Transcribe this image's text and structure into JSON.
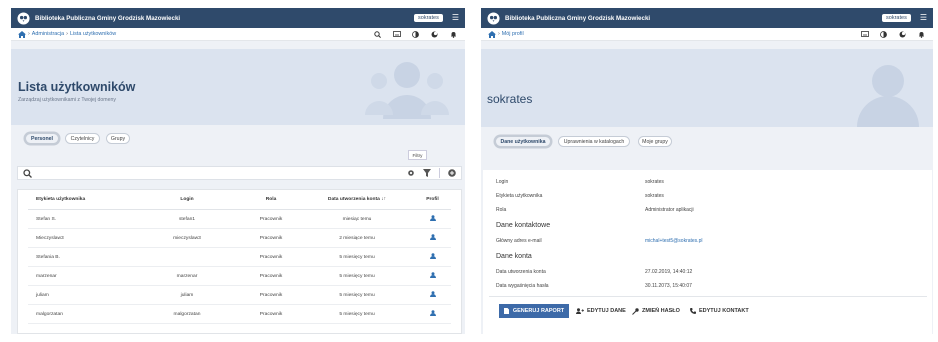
{
  "left": {
    "app_title": "Biblioteka Publiczna Gminy Grodzisk Mazowiecki",
    "user_badge": "sokrates",
    "breadcrumb": [
      "Administracja",
      "Lista użytkowników"
    ],
    "page_title": "Lista użytkowników",
    "page_subtitle": "Zarządzaj użytkownikami z Twojej domeny",
    "tabs": [
      {
        "label": "Personel",
        "active": true
      },
      {
        "label": "Czytelnicy",
        "active": false
      },
      {
        "label": "Grupy",
        "active": false
      }
    ],
    "filter_tooltip": "Filtry",
    "table": {
      "headers": [
        "Etykieta użytkownika",
        "Login",
        "Rola",
        "Data utworzenia konta",
        "Profil"
      ],
      "sort_indicator": "↓↑",
      "rows": [
        [
          "Stefan S.",
          "stefan1",
          "Pracownik",
          "miesiąc temu"
        ],
        [
          "Mieczyslaw3",
          "mieczyslaw3",
          "Pracownik",
          "2 miesiące temu"
        ],
        [
          "Stefania B.",
          "",
          "Pracownik",
          "5 miesięcy temu"
        ],
        [
          "marzenar",
          "marzenar",
          "Pracownik",
          "5 miesięcy temu"
        ],
        [
          "juliam",
          "juliam",
          "Pracownik",
          "5 miesięcy temu"
        ],
        [
          "malgorzatan",
          "malgorzatan",
          "Pracownik",
          "5 miesięcy temu"
        ]
      ]
    }
  },
  "right": {
    "app_title": "Biblioteka Publiczna Gminy Grodzisk Mazowiecki",
    "user_badge": "sokrates",
    "breadcrumb": [
      "Mój profil"
    ],
    "page_title": "sokrates",
    "tabs": [
      {
        "label": "Dane użytkownika",
        "active": true
      },
      {
        "label": "Uprawnienia w katalogach",
        "active": false
      },
      {
        "label": "Moje grupy",
        "active": false
      }
    ],
    "fields": [
      {
        "label": "Login",
        "value": "sokrates"
      },
      {
        "label": "Etykieta użytkownika",
        "value": "sokrates"
      },
      {
        "label": "Rola",
        "value": "Administrator aplikacji"
      }
    ],
    "contact_section": "Dane kontaktowe",
    "email_label": "Główny adres e-mail",
    "email_value": "michal+test5@sokrates.pl",
    "account_section": "Dane konta",
    "created_label": "Data utworzenia konta",
    "created_value": "27.02.2019, 14:40:12",
    "expiry_label": "Data wygaśnięcia hasła",
    "expiry_value": "30.11.2073, 15:40:07",
    "actions": {
      "report": "GENERUJ RAPORT",
      "edit_data": "EDYTUJ DANE",
      "change_password": "ZMIEŃ HASŁO",
      "edit_contact": "EDYTUJ KONTAKT"
    }
  },
  "colors": {
    "nav": "#2f4a6b",
    "hero": "#dbe3ef",
    "accent": "#3d6aa8",
    "link": "#2f6fb0"
  }
}
